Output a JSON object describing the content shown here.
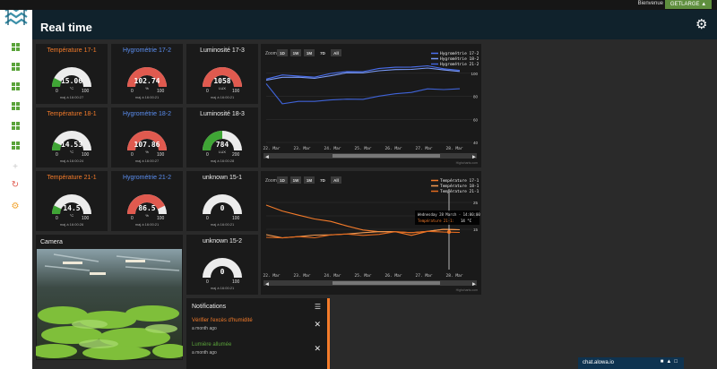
{
  "topbar": {
    "welcome": "Bienvenue",
    "user_button": "GETLARGE",
    "user_icon": "person-icon"
  },
  "header": {
    "title": "Real time"
  },
  "sidebar": {
    "items": [
      "dashboard-1",
      "dashboard-2",
      "dashboard-3",
      "dashboard-4",
      "dashboard-5",
      "dashboard-6",
      "add",
      "sync",
      "settings"
    ]
  },
  "tiles": [
    {
      "title": "Température 17-1",
      "color": "orange",
      "value": "15.06",
      "unit": "°C",
      "min": "0",
      "max": "100",
      "updated": "maj à 16:00:27",
      "fill": 0.15,
      "fillColor": "#3fa535"
    },
    {
      "title": "Hygrométrie 17-2",
      "color": "blue",
      "value": "102.74",
      "unit": "%",
      "min": "0",
      "max": "100",
      "updated": "maj à 16:00:21",
      "fill": 1.0,
      "fillColor": "#e05a4f"
    },
    {
      "title": "Luminosité 17-3",
      "color": "white",
      "value": "1058",
      "unit": "LUX",
      "min": "0",
      "max": "100",
      "updated": "maj à 16:00:21",
      "fill": 1.0,
      "fillColor": "#e05a4f"
    },
    {
      "title": "Température 18-1",
      "color": "orange",
      "value": "14.53",
      "unit": "°C",
      "min": "0",
      "max": "100",
      "updated": "maj à 16:00:24",
      "fill": 0.145,
      "fillColor": "#3fa535"
    },
    {
      "title": "Hygrométrie 18-2",
      "color": "blue",
      "value": "107.86",
      "unit": "%",
      "min": "0",
      "max": "100",
      "updated": "maj à 16:00:27",
      "fill": 1.0,
      "fillColor": "#e05a4f"
    },
    {
      "title": "Luminosité 18-3",
      "color": "white",
      "value": "784",
      "unit": "LUX",
      "min": "0",
      "max": "200",
      "updated": "maj à 16:00:28",
      "fill": 0.5,
      "fillColor": "#3fa535"
    },
    {
      "title": "Température 21-1",
      "color": "orange",
      "value": "14.5",
      "unit": "°C",
      "min": "0",
      "max": "100",
      "updated": "maj à 16:00:26",
      "fill": 0.145,
      "fillColor": "#3fa535"
    },
    {
      "title": "Hygrométrie 21-2",
      "color": "blue",
      "value": "86.5",
      "unit": "%",
      "min": "0",
      "max": "100",
      "updated": "maj à 16:00:21",
      "fill": 0.86,
      "fillColor": "#e05a4f"
    },
    {
      "title": "unknown 15-1",
      "color": "white",
      "value": "0",
      "unit": "",
      "min": "0",
      "max": "100",
      "updated": "maj à 16:00:21",
      "fill": 0,
      "fillColor": "#3fa535"
    },
    {
      "title": "unknown 15-2",
      "color": "white",
      "value": "0",
      "unit": "",
      "min": "0",
      "max": "100",
      "updated": "maj à 16:00:21",
      "fill": 0,
      "fillColor": "#3fa535"
    }
  ],
  "camera": {
    "title": "Camera"
  },
  "chart_data": [
    {
      "type": "line",
      "zoom_label": "Zoom",
      "zoom_buttons": [
        "1D",
        "1W",
        "1M",
        "7D",
        "All"
      ],
      "zoom_active": "7D",
      "legend": [
        "Hygrométrie 17-2",
        "Hygrométrie 18-2",
        "Hygrométrie 21-2"
      ],
      "x": [
        "22. Mar",
        "23. Mar",
        "24. Mar",
        "25. Mar",
        "26. Mar",
        "27. Mar",
        "28. Mar"
      ],
      "y_ticks": [
        "100",
        "80",
        "60",
        "40"
      ],
      "ylim": [
        40,
        110
      ],
      "series": [
        {
          "name": "Hygrométrie 17-2",
          "color": "#4a6ff0",
          "values": [
            95,
            99,
            97,
            97,
            100,
            101,
            102,
            104,
            105,
            106,
            106,
            104,
            103
          ]
        },
        {
          "name": "Hygrométrie 18-2",
          "color": "#7a9af7",
          "values": [
            94,
            97,
            96,
            96,
            98,
            100,
            101,
            102,
            103,
            104,
            104,
            103,
            102
          ]
        },
        {
          "name": "Hygrométrie 21-2",
          "color": "#3f63d8",
          "values": [
            91,
            74,
            75,
            76,
            77,
            77,
            78,
            80,
            82,
            84,
            86,
            86,
            87
          ]
        }
      ],
      "credit": "Highcharts.com"
    },
    {
      "type": "line",
      "zoom_label": "Zoom",
      "zoom_buttons": [
        "1D",
        "1W",
        "1M",
        "7D",
        "All"
      ],
      "zoom_active": "7D",
      "legend": [
        "Température 17-1",
        "Température 18-1",
        "Température 21-1"
      ],
      "x": [
        "22. Mar",
        "23. Mar",
        "24. Mar",
        "25. Mar",
        "26. Mar",
        "27. Mar",
        "28. Mar"
      ],
      "y_ticks": [
        "25",
        "20",
        "15"
      ],
      "ylim": [
        0,
        30
      ],
      "tooltip": {
        "title": "Wednesday 28 March - 14:00:00",
        "label": "Température 21-1:",
        "value": "14 °C"
      },
      "series": [
        {
          "name": "Température 17-1",
          "color": "#f47b2a",
          "values": [
            24,
            22,
            20,
            19,
            18,
            16,
            15,
            14,
            14,
            13,
            14,
            15,
            15
          ]
        },
        {
          "name": "Température 18-1",
          "color": "#f49a52",
          "values": [
            13,
            12,
            12,
            13,
            13,
            13,
            14,
            14,
            14,
            14,
            14,
            15,
            15
          ]
        },
        {
          "name": "Température 21-1",
          "color": "#e36a1e",
          "values": [
            12,
            12,
            12,
            12,
            13,
            13,
            13,
            13,
            14,
            14,
            14,
            14,
            14
          ]
        }
      ],
      "credit": "Highcharts.com"
    }
  ],
  "notifications": {
    "title": "Notifications",
    "items": [
      {
        "title": "Vérifier l'excès d'humidité",
        "time": "a month ago",
        "color": "#f47b2a"
      },
      {
        "title": "Lumière allumée",
        "time": "a month ago",
        "color": "#5aa33a"
      }
    ]
  },
  "chat": {
    "label": "chat.alowa.io"
  }
}
